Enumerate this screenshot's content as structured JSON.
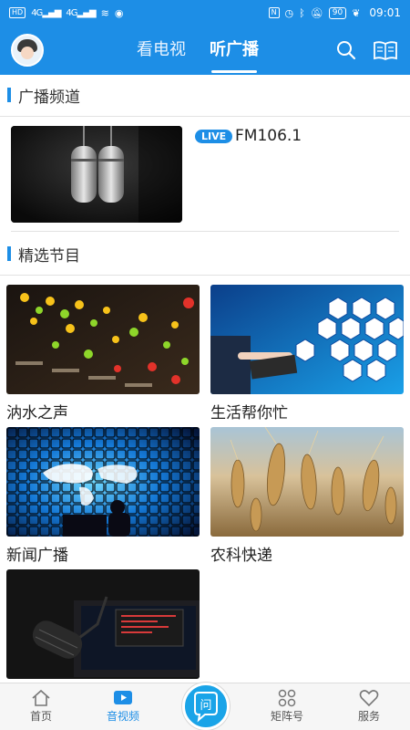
{
  "status_bar": {
    "hd_label": "HD",
    "sim1": "4G",
    "sim2": "4G",
    "battery": "90",
    "time": "09:01"
  },
  "header": {
    "tabs": [
      {
        "label": "看电视",
        "active": false
      },
      {
        "label": "听广播",
        "active": true
      }
    ],
    "icons": [
      "search-icon",
      "book-icon"
    ]
  },
  "channels_section": {
    "title": "广播频道",
    "items": [
      {
        "badge": "LIVE",
        "name": "FM106.1"
      }
    ]
  },
  "programs_section": {
    "title": "精选节目",
    "items": [
      {
        "label": "汭水之声"
      },
      {
        "label": "生活帮你忙"
      },
      {
        "label": "新闻广播"
      },
      {
        "label": "农科快递"
      },
      {
        "label": ""
      }
    ]
  },
  "bottom_nav": {
    "items": [
      {
        "label": "首页",
        "icon": "home-icon",
        "active": false
      },
      {
        "label": "音视频",
        "icon": "video-icon",
        "active": true
      },
      {
        "label": "",
        "icon": "ask-icon",
        "active": false
      },
      {
        "label": "矩阵号",
        "icon": "matrix-icon",
        "active": false
      },
      {
        "label": "服务",
        "icon": "heart-icon",
        "active": false
      }
    ],
    "center_button_glyph": "问"
  },
  "colors": {
    "brand_blue": "#1d8ee6",
    "center_button": "#1aa4e8"
  }
}
